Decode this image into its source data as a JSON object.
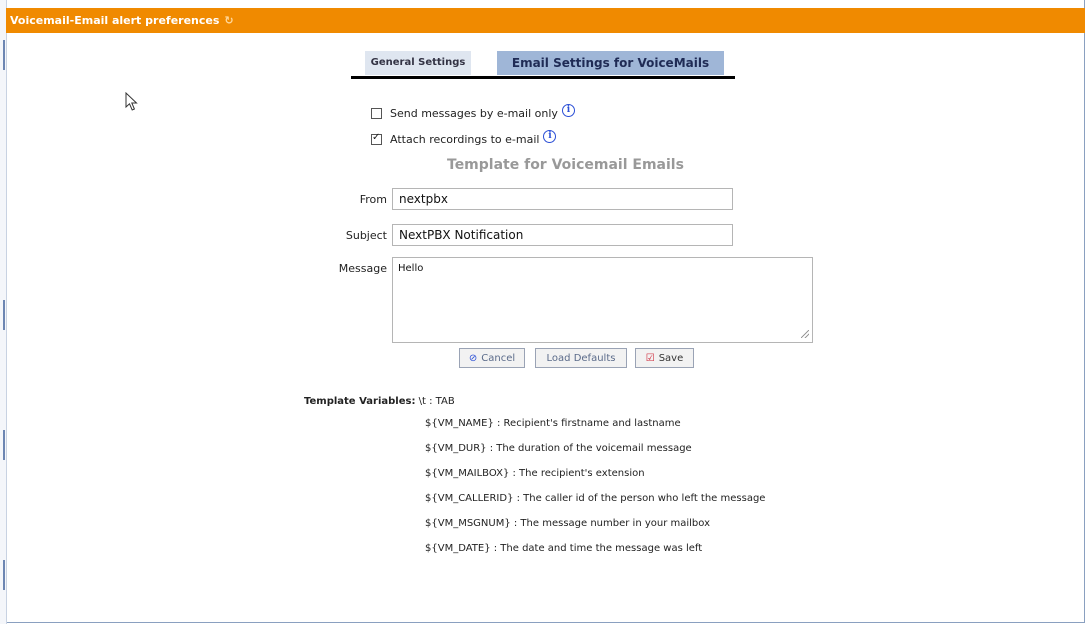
{
  "window": {
    "title": "Voicemail-Email alert preferences",
    "refresh_icon": "refresh-icon"
  },
  "tabs": [
    {
      "label": "General Settings",
      "active": false
    },
    {
      "label": "Email Settings for VoiceMails",
      "active": true
    }
  ],
  "options": {
    "send_email_only": {
      "label": "Send messages by e-mail only",
      "checked": false
    },
    "attach_recordings": {
      "label": "Attach recordings to e-mail",
      "checked": true
    }
  },
  "template": {
    "title": "Template for Voicemail Emails",
    "from_label": "From",
    "from_value": "nextpbx",
    "subject_label": "Subject",
    "subject_value": "NextPBX Notification",
    "message_label": "Message",
    "message_value": "Hello"
  },
  "buttons": {
    "cancel": "Cancel",
    "load_defaults": "Load Defaults",
    "save": "Save"
  },
  "variables": {
    "label": "Template Variables:",
    "tab_hint": "\\t : TAB",
    "items": [
      "${VM_NAME} : Recipient's firstname and lastname",
      "${VM_DUR} : The duration of the voicemail message",
      "${VM_MAILBOX} : The recipient's extension",
      "${VM_CALLERID} : The caller id of the person who left the message",
      "${VM_MSGNUM} : The message number in your mailbox",
      "${VM_DATE} : The date and time the message was left"
    ]
  },
  "colors": {
    "titlebar": "#f08a00",
    "active_tab": "#9fb6d7",
    "inactive_tab": "#dfe6f0",
    "info_icon": "#2b4fd6"
  }
}
